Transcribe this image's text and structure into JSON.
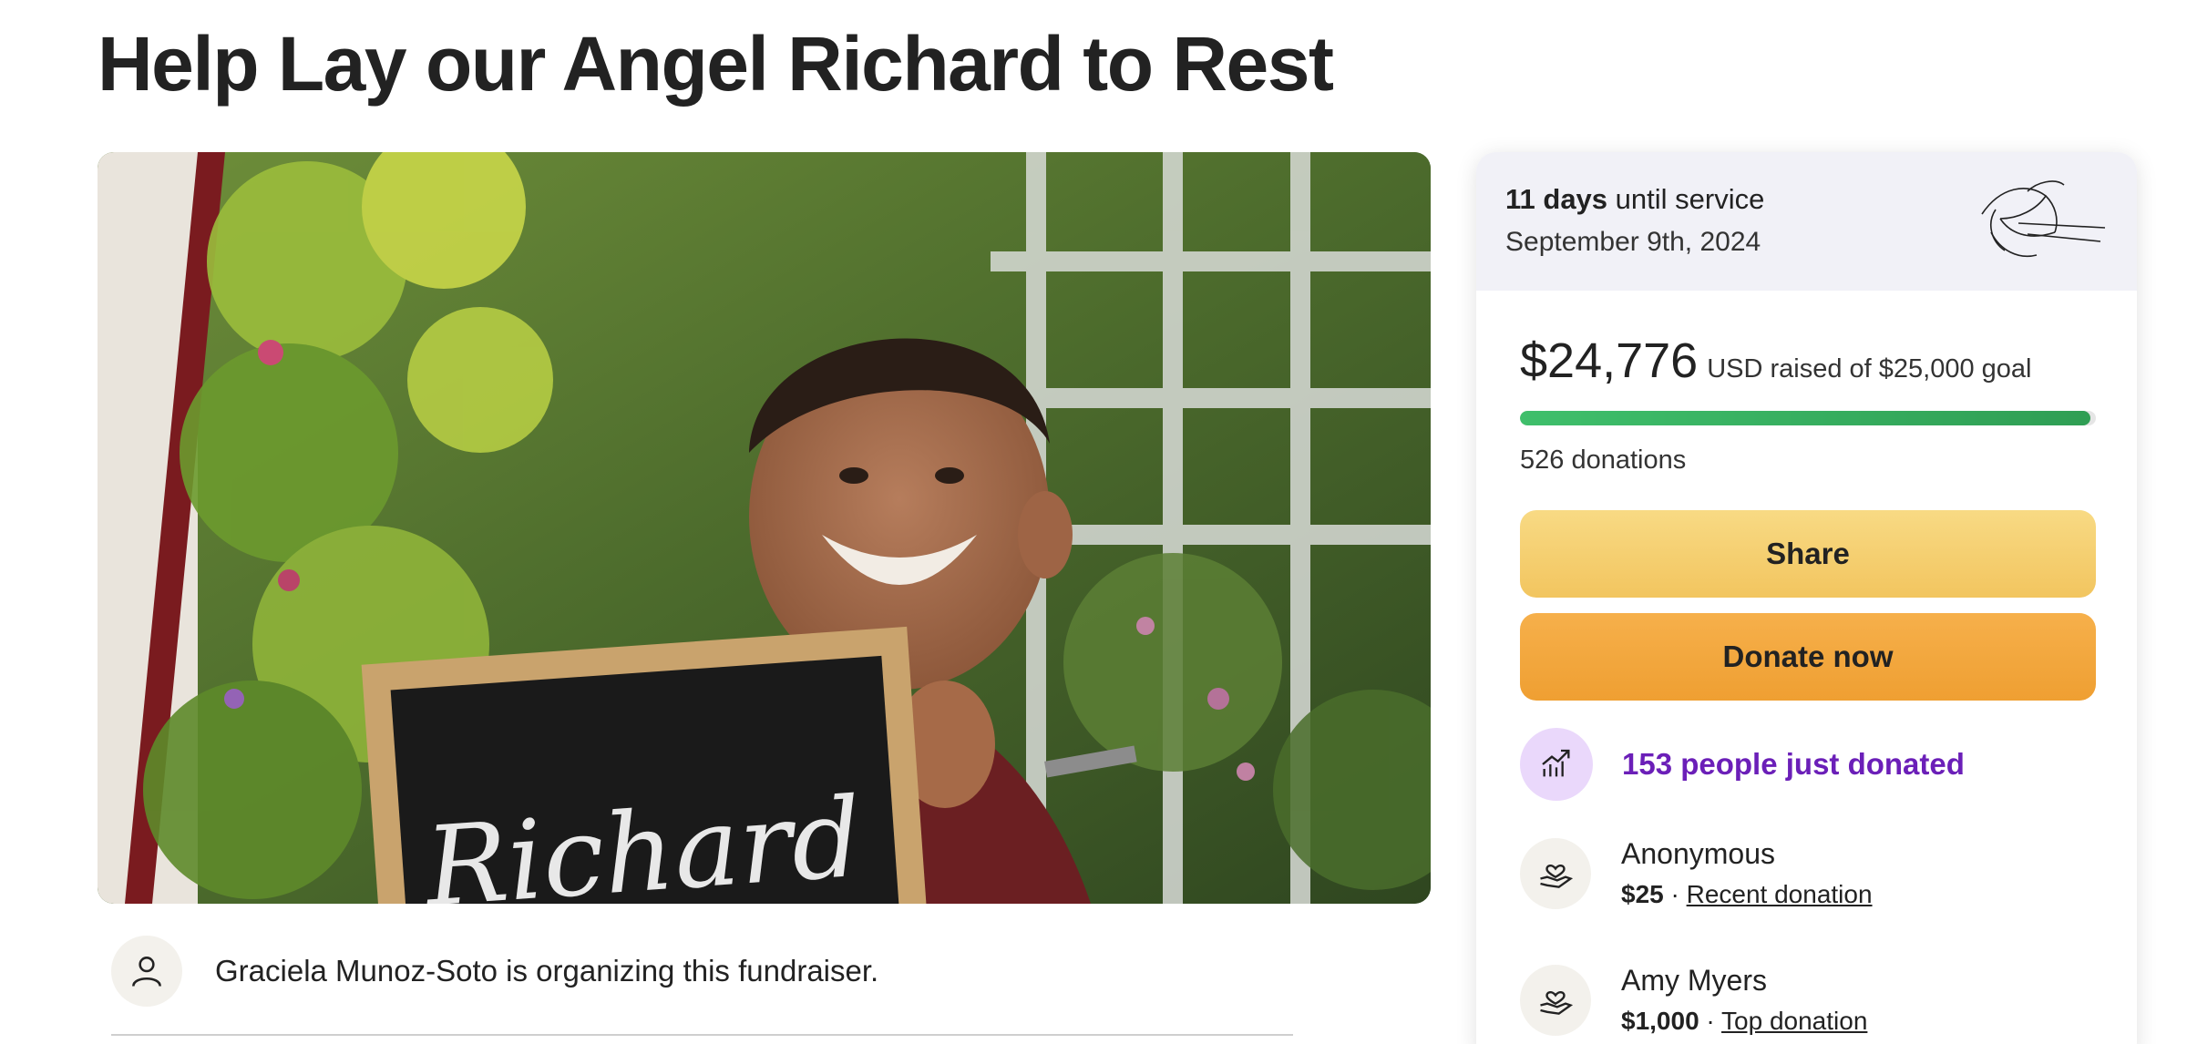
{
  "page": {
    "title": "Help Lay our Angel Richard to Rest"
  },
  "hero": {
    "chalkboard_text": "Richard"
  },
  "organizer": {
    "text": "Graciela Munoz-Soto is organizing this fundraiser.",
    "icon": "user-icon"
  },
  "service": {
    "days": "11 days",
    "until_text": "until service",
    "date": "September 9th, 2024",
    "icon": "lily-icon"
  },
  "stats": {
    "raised": "$24,776",
    "raised_text": "USD raised of $25,000 goal",
    "progress_fraction": 0.991,
    "donations": "526 donations"
  },
  "buttons": {
    "share": "Share",
    "donate": "Donate now"
  },
  "just_donated": {
    "text": "153 people just donated",
    "icon": "trend-up-icon"
  },
  "donors": [
    {
      "name": "Anonymous",
      "amount": "$25",
      "separator": "·",
      "label": "Recent donation",
      "icon": "heart-hand-icon"
    },
    {
      "name": "Amy Myers",
      "amount": "$1,000",
      "separator": "·",
      "label": "Top donation",
      "icon": "heart-hand-icon"
    }
  ],
  "colors": {
    "accent_purple": "#6b1fb8",
    "progress_green": "#34a853",
    "share_yellow": "#f5cf6e",
    "donate_orange": "#f2a63c"
  }
}
